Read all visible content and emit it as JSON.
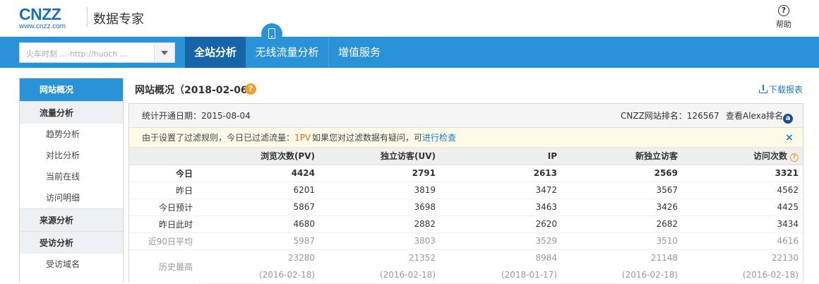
{
  "header": {
    "logo_main": "CNZZ",
    "logo_sub": "www.cnzz.com",
    "title": "数据专家",
    "help_label": "帮助"
  },
  "nav": {
    "site_select_value": "火车时刻 ...-http://huoch ...",
    "tabs": [
      {
        "label": "全站分析",
        "active": true
      },
      {
        "label": "无线流量分析",
        "active": false
      },
      {
        "label": "增值服务",
        "active": false
      }
    ]
  },
  "sidebar": {
    "items": [
      {
        "label": "网站概况",
        "type": "head",
        "active": true
      },
      {
        "label": "流量分析",
        "type": "head"
      },
      {
        "label": "趋势分析",
        "type": "sub"
      },
      {
        "label": "对比分析",
        "type": "sub"
      },
      {
        "label": "当前在线",
        "type": "sub"
      },
      {
        "label": "访问明细",
        "type": "sub"
      },
      {
        "label": "来源分析",
        "type": "head"
      },
      {
        "label": "受访分析",
        "type": "head"
      },
      {
        "label": "受访域名",
        "type": "sub"
      }
    ]
  },
  "main": {
    "title": "网站概况（2018-02-06）",
    "download_label": "下载报表",
    "info": {
      "open_date": "统计开通日期：2015-08-04",
      "rank": "CNZZ网站排名：126567",
      "alexa": "查看Alexa排名"
    },
    "notice": {
      "text": "由于设置了过滤规则，今日已过滤流量：",
      "count": "1PV",
      "text2": "如果您对过滤数据有疑问，可",
      "link": "进行检查",
      "close": "×"
    },
    "table": {
      "columns": [
        "",
        "浏览次数(PV)",
        "独立访客(UV)",
        "IP",
        "新独立访客",
        "访问次数"
      ],
      "rows": [
        [
          "今日",
          "4424",
          "2791",
          "2613",
          "2569",
          "3321"
        ],
        [
          "昨日",
          "6201",
          "3819",
          "3472",
          "3567",
          "4562"
        ],
        [
          "今日预计",
          "5867",
          "3698",
          "3463",
          "3426",
          "4425"
        ],
        [
          "昨日此时",
          "4680",
          "2882",
          "2620",
          "2682",
          "3434"
        ],
        [
          "近90日平均",
          "5987",
          "3803",
          "3529",
          "3510",
          "4616"
        ]
      ],
      "history": {
        "label": "历史最高",
        "values": [
          "23280",
          "21352",
          "8984",
          "21148",
          "22130"
        ],
        "dates": [
          "(2016-02-18)",
          "(2016-02-18)",
          "(2018-01-17)",
          "(2016-02-18)",
          "(2016-02-18)"
        ]
      }
    }
  }
}
